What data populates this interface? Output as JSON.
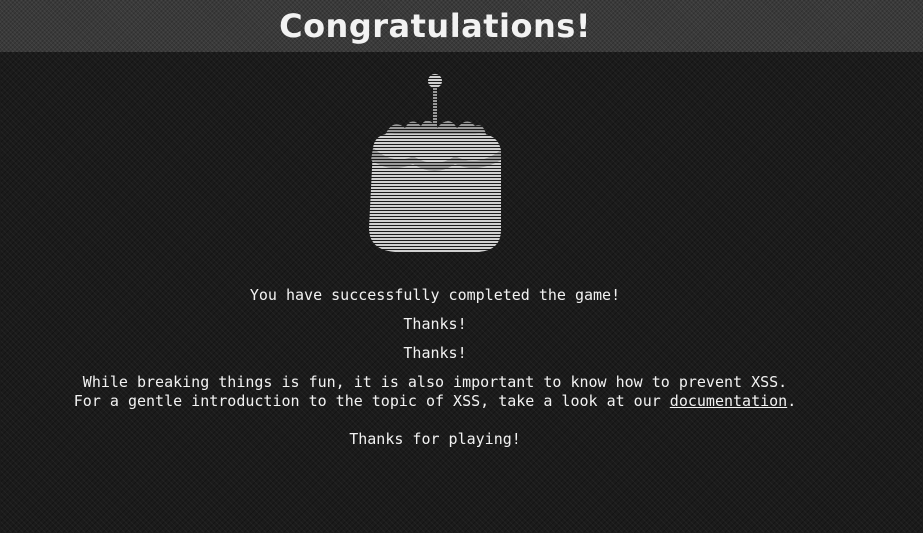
{
  "header": {
    "title": "Congratulations!"
  },
  "image": {
    "icon": "cake-icon"
  },
  "messages": {
    "completed": "You have successfully completed the game!",
    "thanks_1": "Thanks!",
    "thanks_2": "Thanks!",
    "prevent_line": "While breaking things is fun, it is also important to know how to prevent XSS.",
    "intro_prefix": "For a gentle introduction to the topic of XSS, take a look at our ",
    "doc_link": "documentation",
    "intro_suffix": ".",
    "thanks_playing": "Thanks for playing!"
  },
  "colors": {
    "background": "#1b1b1b",
    "header": "#3a3a3a",
    "text": "#f2f2f2"
  }
}
